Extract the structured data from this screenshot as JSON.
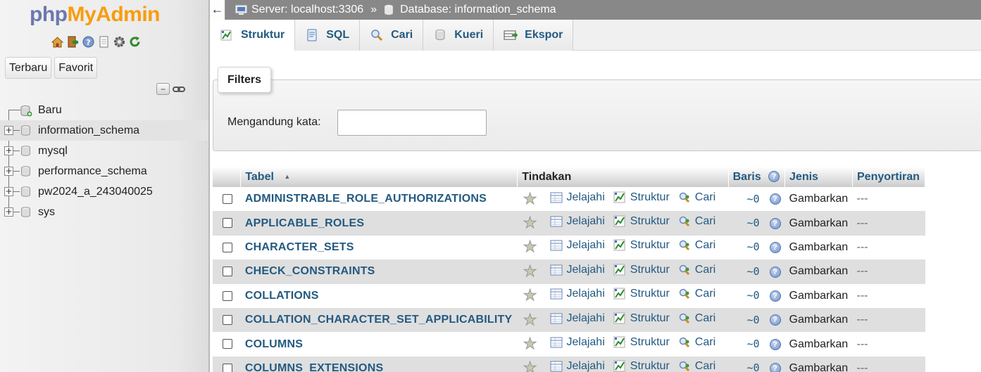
{
  "nav": {
    "logo_php": "php",
    "logo_myadmin": "MyAdmin",
    "icons": [
      "home-icon",
      "exit-icon",
      "help-icon",
      "docs-icon",
      "settings-icon",
      "reload-icon"
    ],
    "tabs": [
      "Terbaru",
      "Favorit"
    ],
    "tree": [
      {
        "label": "Baru",
        "icon": "new-db-icon",
        "expander": ""
      },
      {
        "label": "information_schema",
        "icon": "database-icon",
        "expander": "+",
        "selected": true
      },
      {
        "label": "mysql",
        "icon": "database-icon",
        "expander": "+"
      },
      {
        "label": "performance_schema",
        "icon": "database-icon",
        "expander": "+"
      },
      {
        "label": "pw2024_a_243040025",
        "icon": "database-icon",
        "expander": "+"
      },
      {
        "label": "sys",
        "icon": "database-icon",
        "expander": "+"
      }
    ]
  },
  "topbar": {
    "back": "←",
    "server": "Server: localhost:3306",
    "sep": "»",
    "database": "Database: information_schema"
  },
  "tabs": [
    {
      "label": "Struktur",
      "icon": "structure-icon",
      "active": true
    },
    {
      "label": "SQL",
      "icon": "sql-icon"
    },
    {
      "label": "Cari",
      "icon": "search-icon"
    },
    {
      "label": "Kueri",
      "icon": "query-icon"
    },
    {
      "label": "Ekspor",
      "icon": "export-icon"
    }
  ],
  "filters": {
    "legend": "Filters",
    "label": "Mengandung kata:",
    "value": ""
  },
  "table": {
    "headers": {
      "tabel": "Tabel",
      "sort_indicator": "▲",
      "tindakan": "Tindakan",
      "baris": "Baris",
      "jenis": "Jenis",
      "penyortiran": "Penyortiran"
    },
    "actions": {
      "browse": "Jelajahi",
      "structure": "Struktur",
      "search": "Cari"
    },
    "rows": [
      {
        "name": "ADMINISTRABLE_ROLE_AUTHORIZATIONS",
        "rows": "~0",
        "type": "Gambarkan",
        "collation": "---"
      },
      {
        "name": "APPLICABLE_ROLES",
        "rows": "~0",
        "type": "Gambarkan",
        "collation": "---"
      },
      {
        "name": "CHARACTER_SETS",
        "rows": "~0",
        "type": "Gambarkan",
        "collation": "---"
      },
      {
        "name": "CHECK_CONSTRAINTS",
        "rows": "~0",
        "type": "Gambarkan",
        "collation": "---"
      },
      {
        "name": "COLLATIONS",
        "rows": "~0",
        "type": "Gambarkan",
        "collation": "---"
      },
      {
        "name": "COLLATION_CHARACTER_SET_APPLICABILITY",
        "rows": "~0",
        "type": "Gambarkan",
        "collation": "---"
      },
      {
        "name": "COLUMNS",
        "rows": "~0",
        "type": "Gambarkan",
        "collation": "---"
      },
      {
        "name": "COLUMNS_EXTENSIONS",
        "rows": "~0",
        "type": "Gambarkan",
        "collation": "---"
      }
    ]
  },
  "colors": {
    "link": "#235a81",
    "topbar": "#888888",
    "row_alt": "#dfdfdf",
    "logo_php": "#6c78af",
    "logo_myadmin": "#f89c0e"
  }
}
